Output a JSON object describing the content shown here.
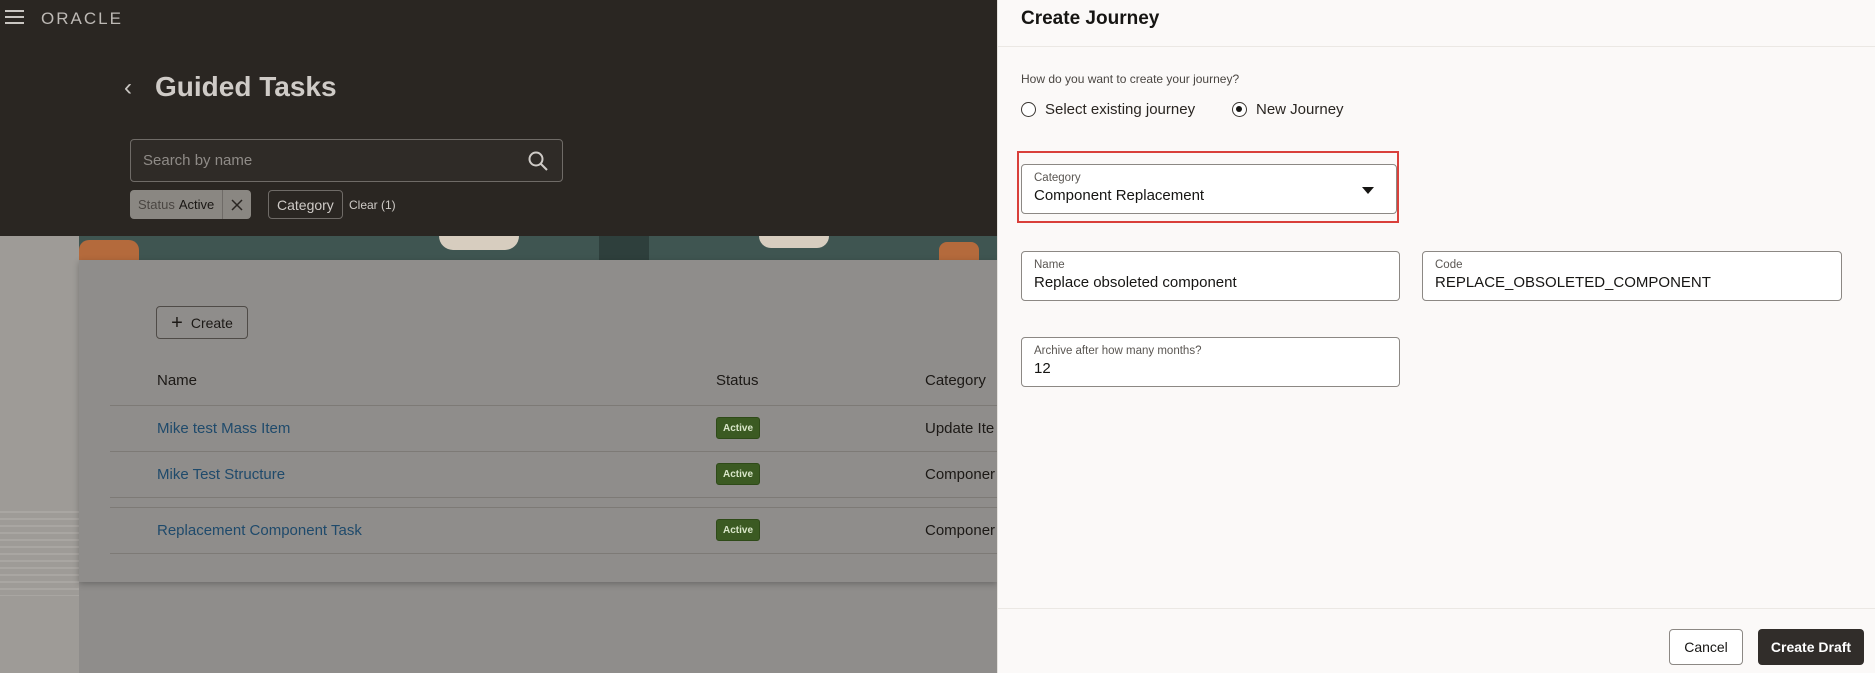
{
  "app": {
    "logo": "ORACLE"
  },
  "page": {
    "title": "Guided Tasks"
  },
  "search": {
    "placeholder": "Search by name"
  },
  "filters": {
    "status_label": "Status",
    "status_value": "Active",
    "category_label": "Category",
    "clear_label": "Clear (1)"
  },
  "list": {
    "create_label": "Create",
    "columns": {
      "name": "Name",
      "status": "Status",
      "category": "Category"
    },
    "rows": [
      {
        "name": "Mike test Mass Item",
        "status": "Active",
        "category": "Update Ite"
      },
      {
        "name": "Mike Test Structure",
        "status": "Active",
        "category": "Componer"
      },
      {
        "name": "Replacement Component Task",
        "status": "Active",
        "category": "Componer"
      }
    ]
  },
  "drawer": {
    "title": "Create Journey",
    "question": "How do you want to create your journey?",
    "radio_existing": "Select existing journey",
    "radio_new": "New Journey",
    "selected_option": "New Journey",
    "category": {
      "label": "Category",
      "value": "Component Replacement"
    },
    "name": {
      "label": "Name",
      "value": "Replace obsoleted component"
    },
    "code": {
      "label": "Code",
      "value": "REPLACE_OBSOLETED_COMPONENT"
    },
    "archive": {
      "label": "Archive after how many months?",
      "value": "12"
    },
    "cancel_label": "Cancel",
    "create_draft_label": "Create Draft"
  },
  "colors": {
    "header_bg": "#2a2622",
    "badge_active": "#3b5a22",
    "link": "#1f4a6b",
    "highlight": "#d9403b",
    "primary_button": "#312d2a"
  }
}
